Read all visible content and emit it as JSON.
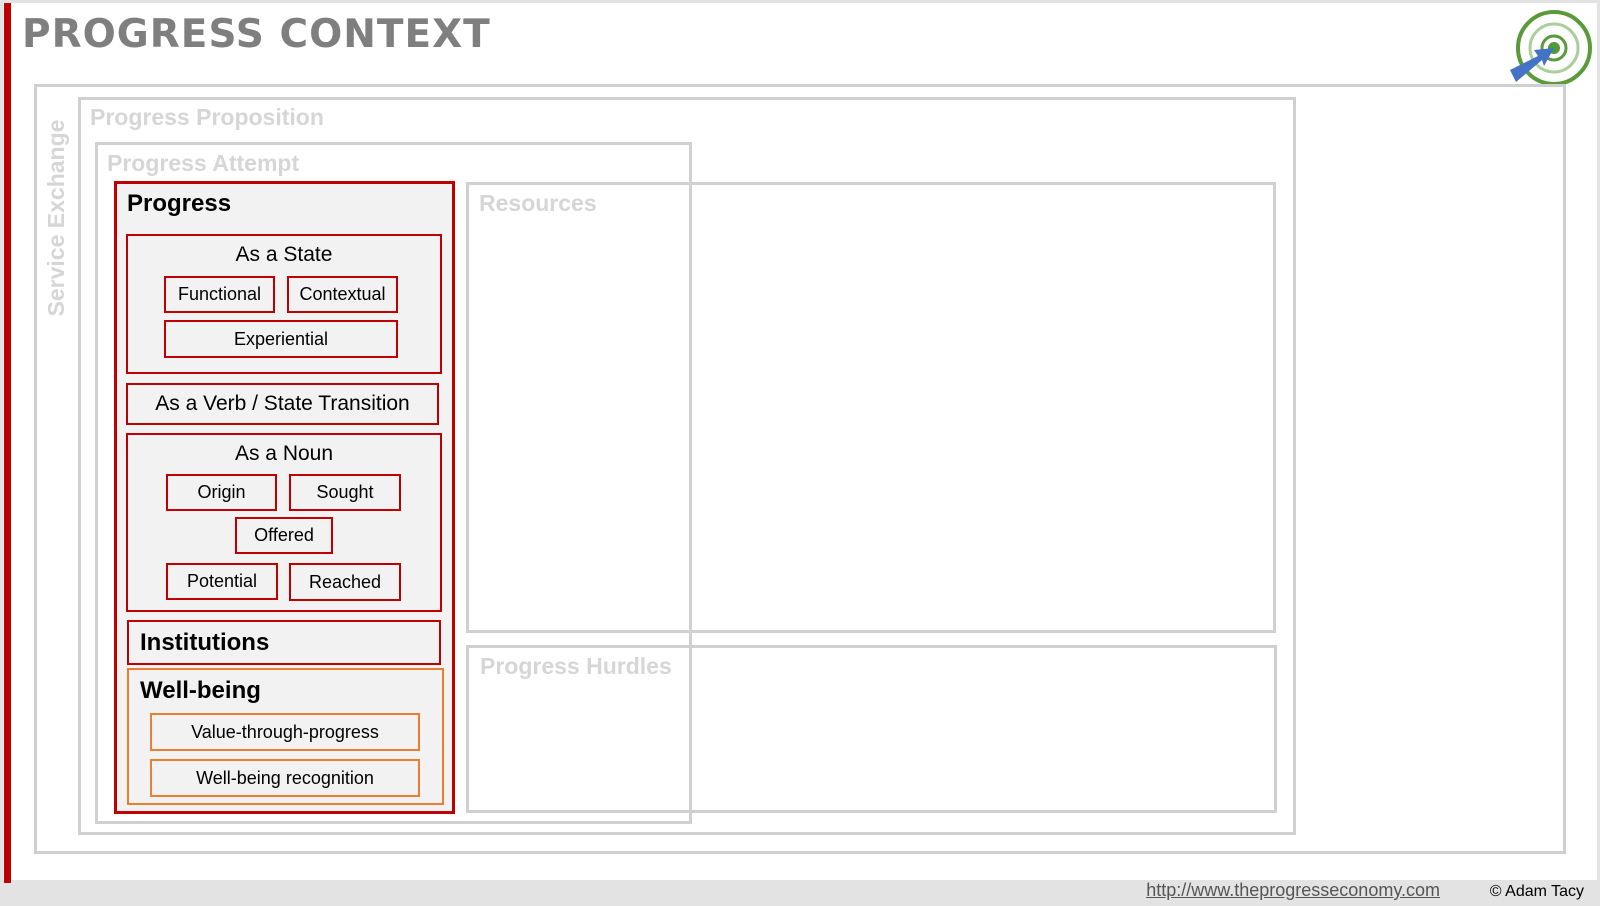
{
  "header": {
    "title": "PROGRESS CONTEXT"
  },
  "regions": {
    "service_exchange": "Service Exchange",
    "progress_proposition": "Progress Proposition",
    "progress_attempt": "Progress Attempt",
    "resources": "Resources",
    "progress_hurdles": "Progress Hurdles"
  },
  "progress_panel": {
    "title": "Progress",
    "as_state": {
      "title": "As a State",
      "items": [
        "Functional",
        "Contextual",
        "Experiential"
      ]
    },
    "as_verb": "As a Verb / State Transition",
    "as_noun": {
      "title": "As a Noun",
      "items": [
        "Origin",
        "Sought",
        "Offered",
        "Potential",
        "Reached"
      ]
    },
    "institutions": "Institutions",
    "wellbeing": {
      "title": "Well-being",
      "items": [
        "Value-through-progress",
        "Well-being recognition"
      ]
    }
  },
  "footer": {
    "link": "http://www.theprogresseconomy.com",
    "copyright": "© Adam Tacy"
  },
  "colors": {
    "accent_red": "#c00000",
    "accent_orange": "#ed7d31",
    "logo_green": "#5a9a3a",
    "arrow_blue": "#4472c4"
  },
  "icons": {
    "logo": "target-with-arrow-icon"
  }
}
